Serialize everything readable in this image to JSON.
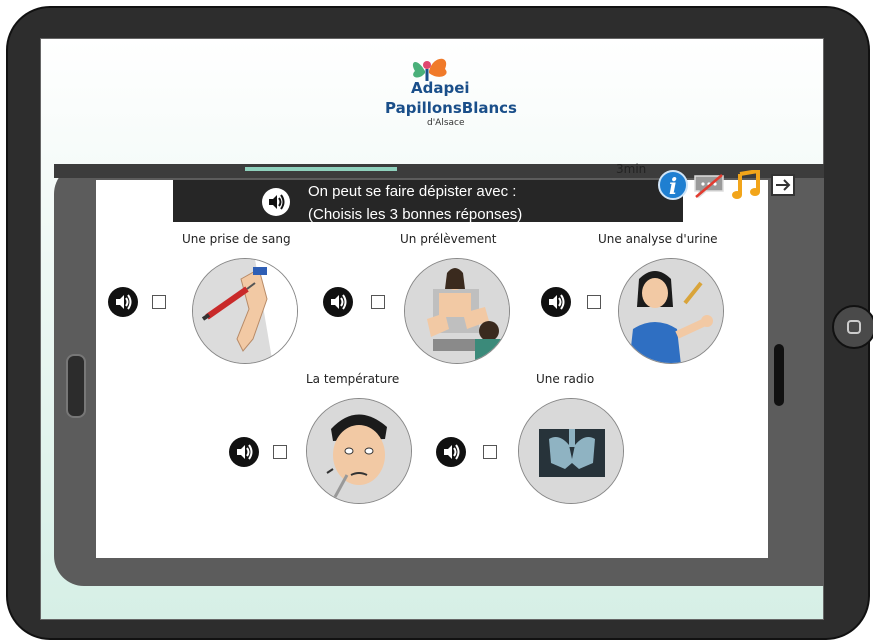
{
  "logo": {
    "line1": "Adapei",
    "line2": "PapillonsBlancs",
    "line3": "d'Alsace"
  },
  "status": {
    "timer": "3min",
    "progress": 0.25
  },
  "toolbar": {
    "info_glyph": "i",
    "icons": [
      "info-icon",
      "chat-muted-icon",
      "music-icon",
      "exit-icon"
    ]
  },
  "question": {
    "line1": "On peut se faire dépister avec :",
    "line2": "(Choisis les 3 bonnes réponses)"
  },
  "options": [
    {
      "label": "Une prise de sang",
      "checked": false,
      "image": "blood-draw-icon"
    },
    {
      "label": "Un prélèvement",
      "checked": false,
      "image": "gynecological-exam-icon"
    },
    {
      "label": "Une analyse d'urine",
      "checked": false,
      "image": "urine-test-icon"
    },
    {
      "label": "La température",
      "checked": false,
      "image": "thermometer-icon"
    },
    {
      "label": "Une radio",
      "checked": false,
      "image": "xray-icon"
    }
  ],
  "colors": {
    "question_bg": "#262626",
    "info_blue": "#1f7fd1",
    "music_orange": "#f2a51a",
    "progress": "#8fd1bd"
  }
}
